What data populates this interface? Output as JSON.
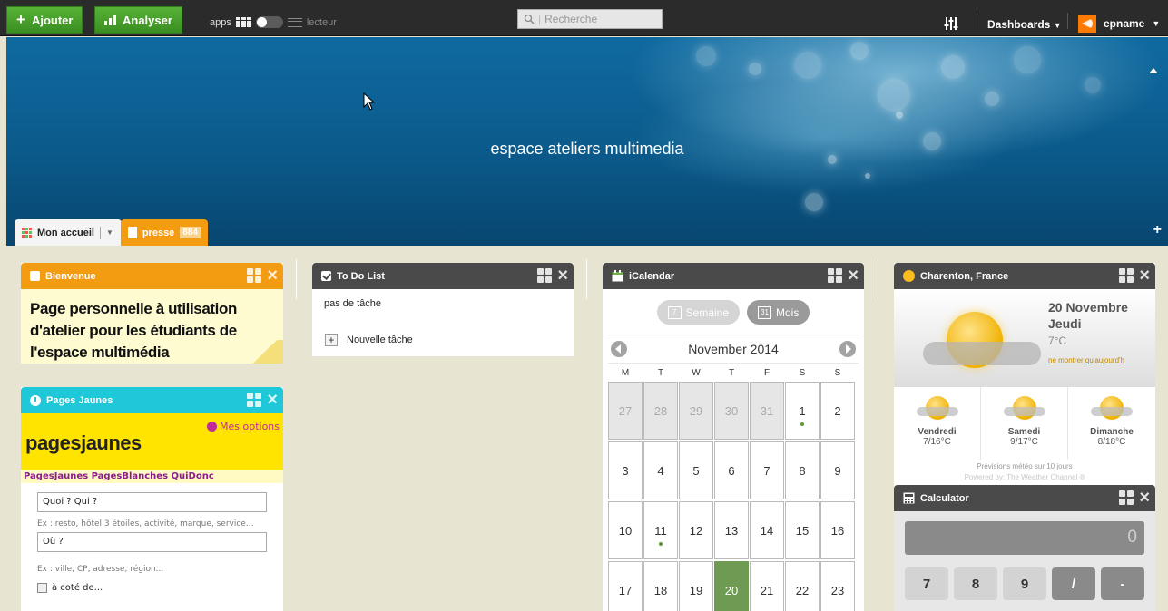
{
  "topbar": {
    "add_label": "Ajouter",
    "analyze_label": "Analyser",
    "apps_label": "apps",
    "reader_label": "lecteur",
    "search_placeholder": "Recherche",
    "dashboards_label": "Dashboards",
    "user_label": "epname"
  },
  "banner": {
    "title": "espace ateliers multimedia"
  },
  "tabs": [
    {
      "label": "Mon accueil"
    },
    {
      "label": "presse",
      "count": "884"
    }
  ],
  "widgets": {
    "welcome": {
      "title": "Bienvenue",
      "text": "Page personnelle à utilisation d'atelier pour les étudiants de l'espace multimédia"
    },
    "pagesjaunes": {
      "title": "Pages Jaunes",
      "logo": "pagesjaunes",
      "options_label": "Mes options",
      "links": "PagesJaunes PagesBlanches QuiDonc",
      "what_value": "Quoi ? Qui ?",
      "what_hint": "Ex : resto, hôtel 3 étoiles, activité, marque, service...",
      "where_value": "Où ?",
      "where_hint": "Ex : ville, CP, adresse, région...",
      "nearby_label": "à coté de..."
    },
    "todo": {
      "title": "To Do List",
      "empty_text": "pas de tâche",
      "new_task_label": "Nouvelle tâche"
    },
    "calendar": {
      "title": "iCalendar",
      "week_label": "Semaine",
      "week_icon": "7",
      "month_label": "Mois",
      "month_icon": "31",
      "month_name": "November 2014",
      "weekdays": [
        "M",
        "T",
        "W",
        "T",
        "F",
        "S",
        "S"
      ],
      "days": [
        {
          "d": "27",
          "muted": true
        },
        {
          "d": "28",
          "muted": true
        },
        {
          "d": "29",
          "muted": true
        },
        {
          "d": "30",
          "muted": true
        },
        {
          "d": "31",
          "muted": true
        },
        {
          "d": "1",
          "event": true
        },
        {
          "d": "2"
        },
        {
          "d": "3"
        },
        {
          "d": "4"
        },
        {
          "d": "5"
        },
        {
          "d": "6"
        },
        {
          "d": "7"
        },
        {
          "d": "8"
        },
        {
          "d": "9"
        },
        {
          "d": "10"
        },
        {
          "d": "11",
          "event": true
        },
        {
          "d": "12"
        },
        {
          "d": "13"
        },
        {
          "d": "14"
        },
        {
          "d": "15"
        },
        {
          "d": "16"
        },
        {
          "d": "17"
        },
        {
          "d": "18"
        },
        {
          "d": "19"
        },
        {
          "d": "20",
          "today": true
        },
        {
          "d": "21"
        },
        {
          "d": "22"
        },
        {
          "d": "23"
        }
      ]
    },
    "weather": {
      "title": "Charenton, France",
      "date": "20 Novembre",
      "weekday": "Jeudi",
      "temp": "7°C",
      "today_only_link": "ne montrer qu'aujourd'h",
      "forecast": [
        {
          "day": "Vendredi",
          "temp": "7/16°C"
        },
        {
          "day": "Samedi",
          "temp": "9/17°C"
        },
        {
          "day": "Dimanche",
          "temp": "8/18°C"
        }
      ],
      "forecast_note": "Prévisions météo sur 10 jours",
      "powered_by": "Powered by: The Weather Channel ®"
    },
    "calculator": {
      "title": "Calculator",
      "display": "0",
      "keys": [
        "7",
        "8",
        "9",
        "/",
        "-"
      ]
    }
  },
  "colors": {
    "topbar": "#2b2b2b",
    "green_button": "#4ca52c",
    "orange": "#f39c12",
    "cyan": "#1ec8d8",
    "widget_dark": "#4a4a4a",
    "today": "#6f9a54",
    "background": "#e8e4d2"
  },
  "icons": [
    "plus-icon",
    "bar-chart-icon",
    "grid-icon",
    "toggle-switch",
    "list-icon",
    "search-icon",
    "mixer-icon",
    "chevron-down-icon",
    "user-logo-icon",
    "grid-handle-icon",
    "close-icon",
    "checkbox-icon",
    "clock-icon",
    "sun-icon",
    "calendar-icon",
    "calculator-icon"
  ]
}
